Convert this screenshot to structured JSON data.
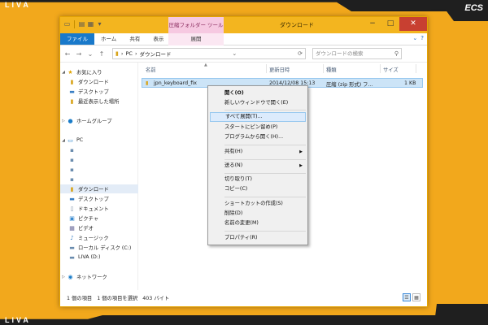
{
  "branding": {
    "liva_top": "LIVA",
    "liva_bottom": "LIVA",
    "ecs": "ECS"
  },
  "window": {
    "title": "ダウンロード",
    "context_tab_title": "圧縮フォルダー ツール",
    "controls": {
      "minimize": "−",
      "maximize": "□",
      "close": "✕"
    }
  },
  "ribbon": {
    "tabs": [
      "ファイル",
      "ホーム",
      "共有",
      "表示"
    ],
    "context_tab": "展開",
    "help_icon": "?"
  },
  "address": {
    "path": [
      "PC",
      "ダウンロード"
    ],
    "separator": "›",
    "search_placeholder": "ダウンロードの検索"
  },
  "nav_pane": {
    "favorites_header": "お気に入り",
    "favorites": [
      "ダウンロード",
      "デスクトップ",
      "最近表示した場所"
    ],
    "homegroup": "ホームグループ",
    "pc_header": "PC",
    "pc_items": [
      "",
      "",
      "",
      "",
      "ダウンロード",
      "デスクトップ",
      "ドキュメント",
      "ピクチャ",
      "ビデオ",
      "ミュージック",
      "ローカル ディスク (C:)",
      "LIVA (D:)"
    ],
    "network": "ネットワーク"
  },
  "columns": {
    "name": "名前",
    "date": "更新日時",
    "type": "種類",
    "size": "サイズ"
  },
  "files": [
    {
      "name": "jpn_keyboard_fix",
      "date": "2014/12/08 15:13",
      "type": "圧縮 (zip 形式) フ...",
      "size": "1 KB"
    }
  ],
  "context_menu": {
    "open": "開く(O)",
    "open_new_window": "新しいウィンドウで開く(E)",
    "extract_all": "すべて展開(T)...",
    "pin_start": "スタートにピン留め(P)",
    "open_with": "プログラムから開く(H)...",
    "share": "共有(H)",
    "send_to": "送る(N)",
    "cut": "切り取り(T)",
    "copy": "コピー(C)",
    "create_shortcut": "ショートカットの作成(S)",
    "delete": "削除(D)",
    "rename": "名前の変更(M)",
    "properties": "プロパティ(R)"
  },
  "status": {
    "count": "1 個の項目",
    "selected": "1 個の項目を選択",
    "size": "403 バイト"
  }
}
